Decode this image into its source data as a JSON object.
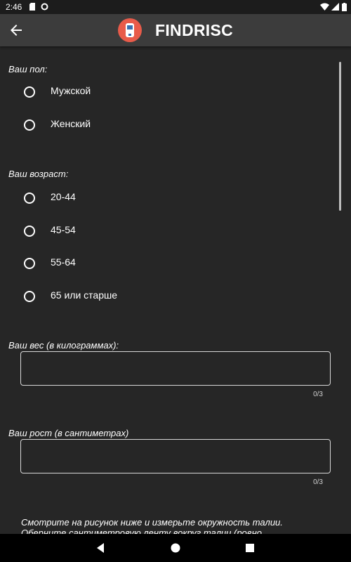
{
  "status_bar": {
    "time": "2:46"
  },
  "app_bar": {
    "title": "FINDRISC",
    "back_icon": "arrow-back-icon",
    "logo_icon": "glucometer-icon",
    "logo_color": "#e85b4a"
  },
  "form": {
    "gender": {
      "label": "Ваш пол:",
      "options": [
        "Мужской",
        "Женский"
      ]
    },
    "age": {
      "label": "Ваш возраст:",
      "options": [
        "20-44",
        "45-54",
        "55-64",
        "65 или старше"
      ]
    },
    "weight": {
      "label": "Ваш вес (в килограммах):",
      "value": "",
      "counter": "0/3"
    },
    "height": {
      "label": "Ваш рост (в сантиметрах)",
      "value": "",
      "counter": "0/3"
    },
    "waist_instructions": "Смотрите на рисунок ниже и измерьте окружность талии. Оберните сантиметровую ленту вокруг талии (ровно горизонтально"
  },
  "nav_bar": {
    "back": "triangle-back-icon",
    "home": "circle-home-icon",
    "recents": "square-recents-icon"
  }
}
